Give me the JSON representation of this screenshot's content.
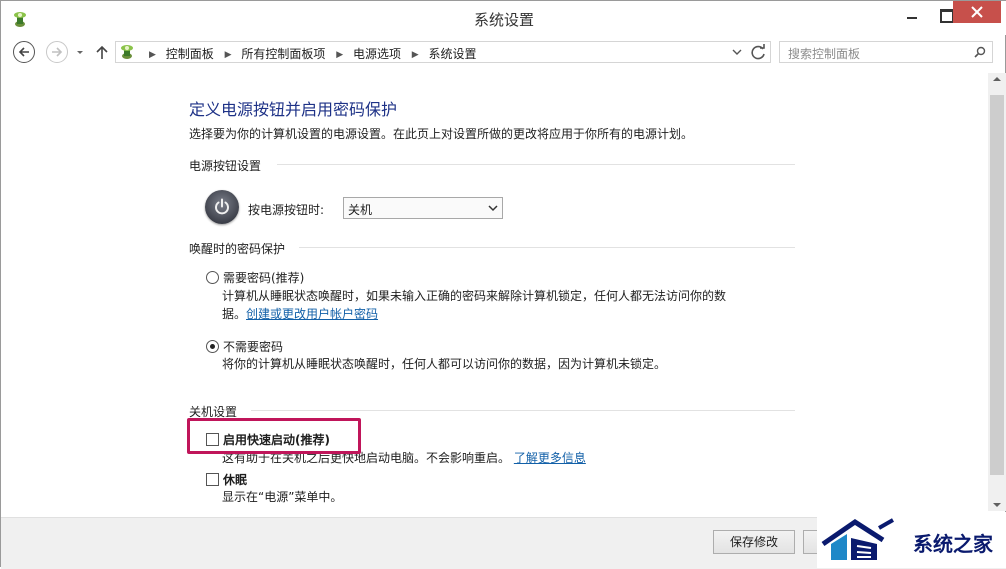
{
  "window": {
    "title": "系统设置"
  },
  "address": {
    "crumbs": [
      "控制面板",
      "所有控制面板项",
      "电源选项",
      "系统设置"
    ],
    "search_placeholder": "搜索控制面板"
  },
  "main": {
    "title": "定义电源按钮并启用密码保护",
    "description": "选择要为你的计算机设置的电源设置。在此页上对设置所做的更改将应用于你所有的电源计划。",
    "power_section": {
      "heading": "电源按钮设置",
      "label": "按电源按钮时:",
      "selected": "关机"
    },
    "password_section": {
      "heading": "唤醒时的密码保护",
      "require": {
        "label": "需要密码(推荐)",
        "desc_line1": "计算机从睡眠状态唤醒时，如果未输入正确的密码来解除计算机锁定，任何人都无法访问你的数",
        "desc_line2_prefix": "据。",
        "link": "创建或更改用户帐户密码",
        "checked": false
      },
      "no_require": {
        "label": "不需要密码",
        "desc": "将你的计算机从睡眠状态唤醒时，任何人都可以访问你的数据，因为计算机未锁定。",
        "checked": true
      }
    },
    "shutdown_section": {
      "heading": "关机设置",
      "fast_startup": {
        "label": "启用快速启动(推荐)",
        "desc": "这有助于在关机之后更快地启动电脑。不会影响重启。",
        "link": "了解更多信息",
        "checked": false
      },
      "sleep": {
        "label": "休眠",
        "desc": "显示在“电源”菜单中。",
        "checked": false
      }
    }
  },
  "footer": {
    "save_label": "保存修改"
  },
  "watermark": {
    "text": "系统之家"
  },
  "colors": {
    "title_blue": "#1e3287",
    "link_blue": "#1260a8",
    "highlight": "#c0155a",
    "close_red": "#c7504b"
  }
}
